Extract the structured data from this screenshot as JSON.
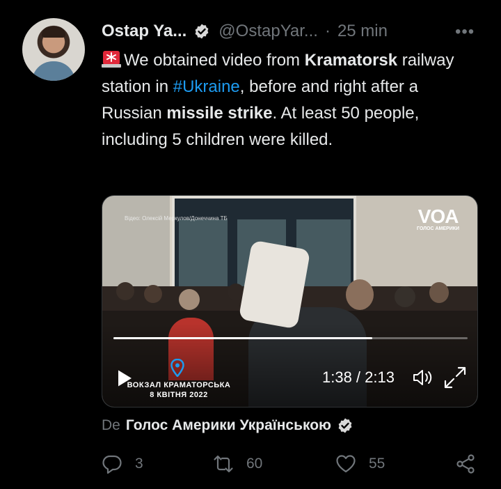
{
  "tweet": {
    "author_name": "Ostap Ya...",
    "handle": "@OstapYar...",
    "separator": "·",
    "time": "25 min",
    "more_label": "•••",
    "text": {
      "p1": "We obtained video from ",
      "p2": "Kramatorsk",
      "p3": " railway station in ",
      "hashtag": "#Ukraine",
      "p4": ", before and right after a Russian ",
      "p5": "missile strike",
      "p6": ". At least 50 people, including 5 children were killed."
    }
  },
  "video": {
    "credit": "Відео: Олексій Меркулов/Донеччина ТБ",
    "logo": "VOA",
    "logo_sub": "ГОЛОС АМЕРИКИ",
    "location_line1": "ВОКЗАЛ КРАМАТОРСЬКА",
    "location_line2": "8 КВІТНЯ 2022",
    "time": "1:38 / 2:13",
    "progress": 0.73
  },
  "source": {
    "prefix": "De",
    "channel": "Голос Америки Українською"
  },
  "actions": {
    "replies": "3",
    "retweets": "60",
    "likes": "55"
  },
  "colors": {
    "background": "#000000",
    "text": "#e7e9ea",
    "muted": "#71767b",
    "link": "#1d9bf0"
  },
  "icons": [
    "verified-icon",
    "siren-icon",
    "play-icon",
    "location-pin-icon",
    "volume-icon",
    "fullscreen-icon",
    "reply-icon",
    "retweet-icon",
    "like-icon",
    "share-icon"
  ]
}
